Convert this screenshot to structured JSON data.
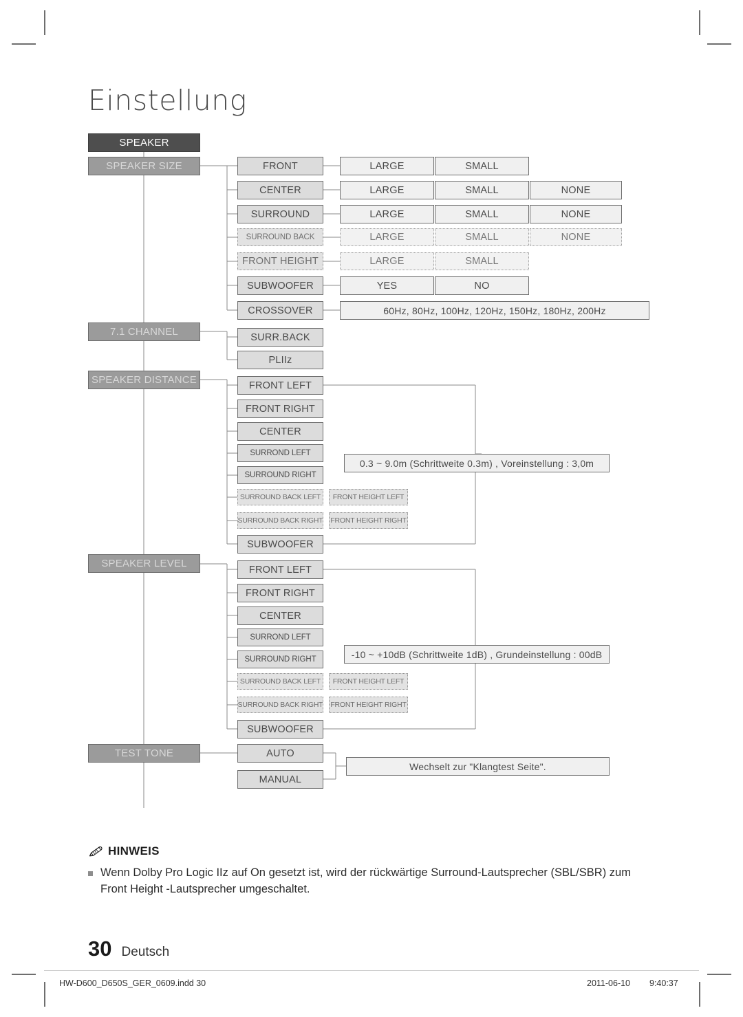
{
  "page": {
    "title": "Einstellung",
    "number": "30",
    "language": "Deutsch"
  },
  "diagram": {
    "root": {
      "label": "SPEAKER"
    },
    "categories": [
      {
        "id": "speaker-size",
        "label": "SPEAKER SIZE"
      },
      {
        "id": "7-1-channel",
        "label": "7.1 CHANNEL"
      },
      {
        "id": "speaker-distance",
        "label": "SPEAKER DISTANCE"
      },
      {
        "id": "speaker-level",
        "label": "SPEAKER LEVEL"
      },
      {
        "id": "test-tone",
        "label": "TEST TONE"
      }
    ],
    "speaker_size": {
      "items": [
        {
          "label": "FRONT",
          "dotted": false,
          "values": [
            "LARGE",
            "SMALL"
          ]
        },
        {
          "label": "CENTER",
          "dotted": false,
          "values": [
            "LARGE",
            "SMALL",
            "NONE"
          ]
        },
        {
          "label": "SURROUND",
          "dotted": false,
          "values": [
            "LARGE",
            "SMALL",
            "NONE"
          ]
        },
        {
          "label": "SURROUND BACK",
          "dotted": true,
          "values": [
            "LARGE",
            "SMALL",
            "NONE"
          ]
        },
        {
          "label": "FRONT HEIGHT",
          "dotted": true,
          "values": [
            "LARGE",
            "SMALL"
          ]
        },
        {
          "label": "SUBWOOFER",
          "dotted": false,
          "values": [
            "YES",
            "NO"
          ]
        },
        {
          "label": "CROSSOVER",
          "dotted": false,
          "values": [
            "60Hz, 80Hz, 100Hz, 120Hz, 150Hz, 180Hz, 200Hz"
          ]
        }
      ]
    },
    "channel_7_1": {
      "items": [
        {
          "label": "SURR.BACK"
        },
        {
          "label": "PLIIz"
        }
      ]
    },
    "speaker_distance": {
      "items": [
        {
          "label": "FRONT LEFT",
          "alt": null,
          "dotted": false
        },
        {
          "label": "FRONT RIGHT",
          "alt": null,
          "dotted": false
        },
        {
          "label": "CENTER",
          "alt": null,
          "dotted": false
        },
        {
          "label": "SURROND LEFT",
          "alt": null,
          "dotted": false
        },
        {
          "label": "SURROUND RIGHT",
          "alt": null,
          "dotted": false
        },
        {
          "label": "SURROUND BACK LEFT",
          "alt": "FRONT HEIGHT LEFT",
          "dotted": true
        },
        {
          "label": "SURROUND BACK RIGHT",
          "alt": "FRONT HEIGHT RIGHT",
          "dotted": true
        },
        {
          "label": "SUBWOOFER",
          "alt": null,
          "dotted": false
        }
      ],
      "range": "0.3 ~ 9.0m (Schrittweite 0.3m) , Voreinstellung : 3,0m"
    },
    "speaker_level": {
      "items": [
        {
          "label": "FRONT LEFT",
          "alt": null,
          "dotted": false
        },
        {
          "label": "FRONT RIGHT",
          "alt": null,
          "dotted": false
        },
        {
          "label": "CENTER",
          "alt": null,
          "dotted": false
        },
        {
          "label": "SURROND LEFT",
          "alt": null,
          "dotted": false
        },
        {
          "label": "SURROUND RIGHT",
          "alt": null,
          "dotted": false
        },
        {
          "label": "SURROUND BACK LEFT",
          "alt": "FRONT HEIGHT LEFT",
          "dotted": true
        },
        {
          "label": "SURROUND BACK RIGHT",
          "alt": "FRONT HEIGHT RIGHT",
          "dotted": true
        },
        {
          "label": "SUBWOOFER",
          "alt": null,
          "dotted": false
        }
      ],
      "range": "-10 ~ +10dB (Schrittweite 1dB) , Grundeinstellung : 00dB"
    },
    "test_tone": {
      "items": [
        {
          "label": "AUTO"
        },
        {
          "label": "MANUAL"
        }
      ],
      "result": "Wechselt zur \"Klangtest Seite\"."
    }
  },
  "note": {
    "icon": "pencil-icon",
    "heading": "HINWEIS",
    "items": [
      "Wenn Dolby Pro Logic IIz auf On gesetzt ist, wird der rückwärtige Surround-Lautsprecher (SBL/SBR) zum Front Height -Lautsprecher umgeschaltet."
    ]
  },
  "imprint": {
    "filename": "HW-D600_D650S_GER_0609.indd   30",
    "date": "2011-06-10",
    "time": "9:40:37"
  }
}
